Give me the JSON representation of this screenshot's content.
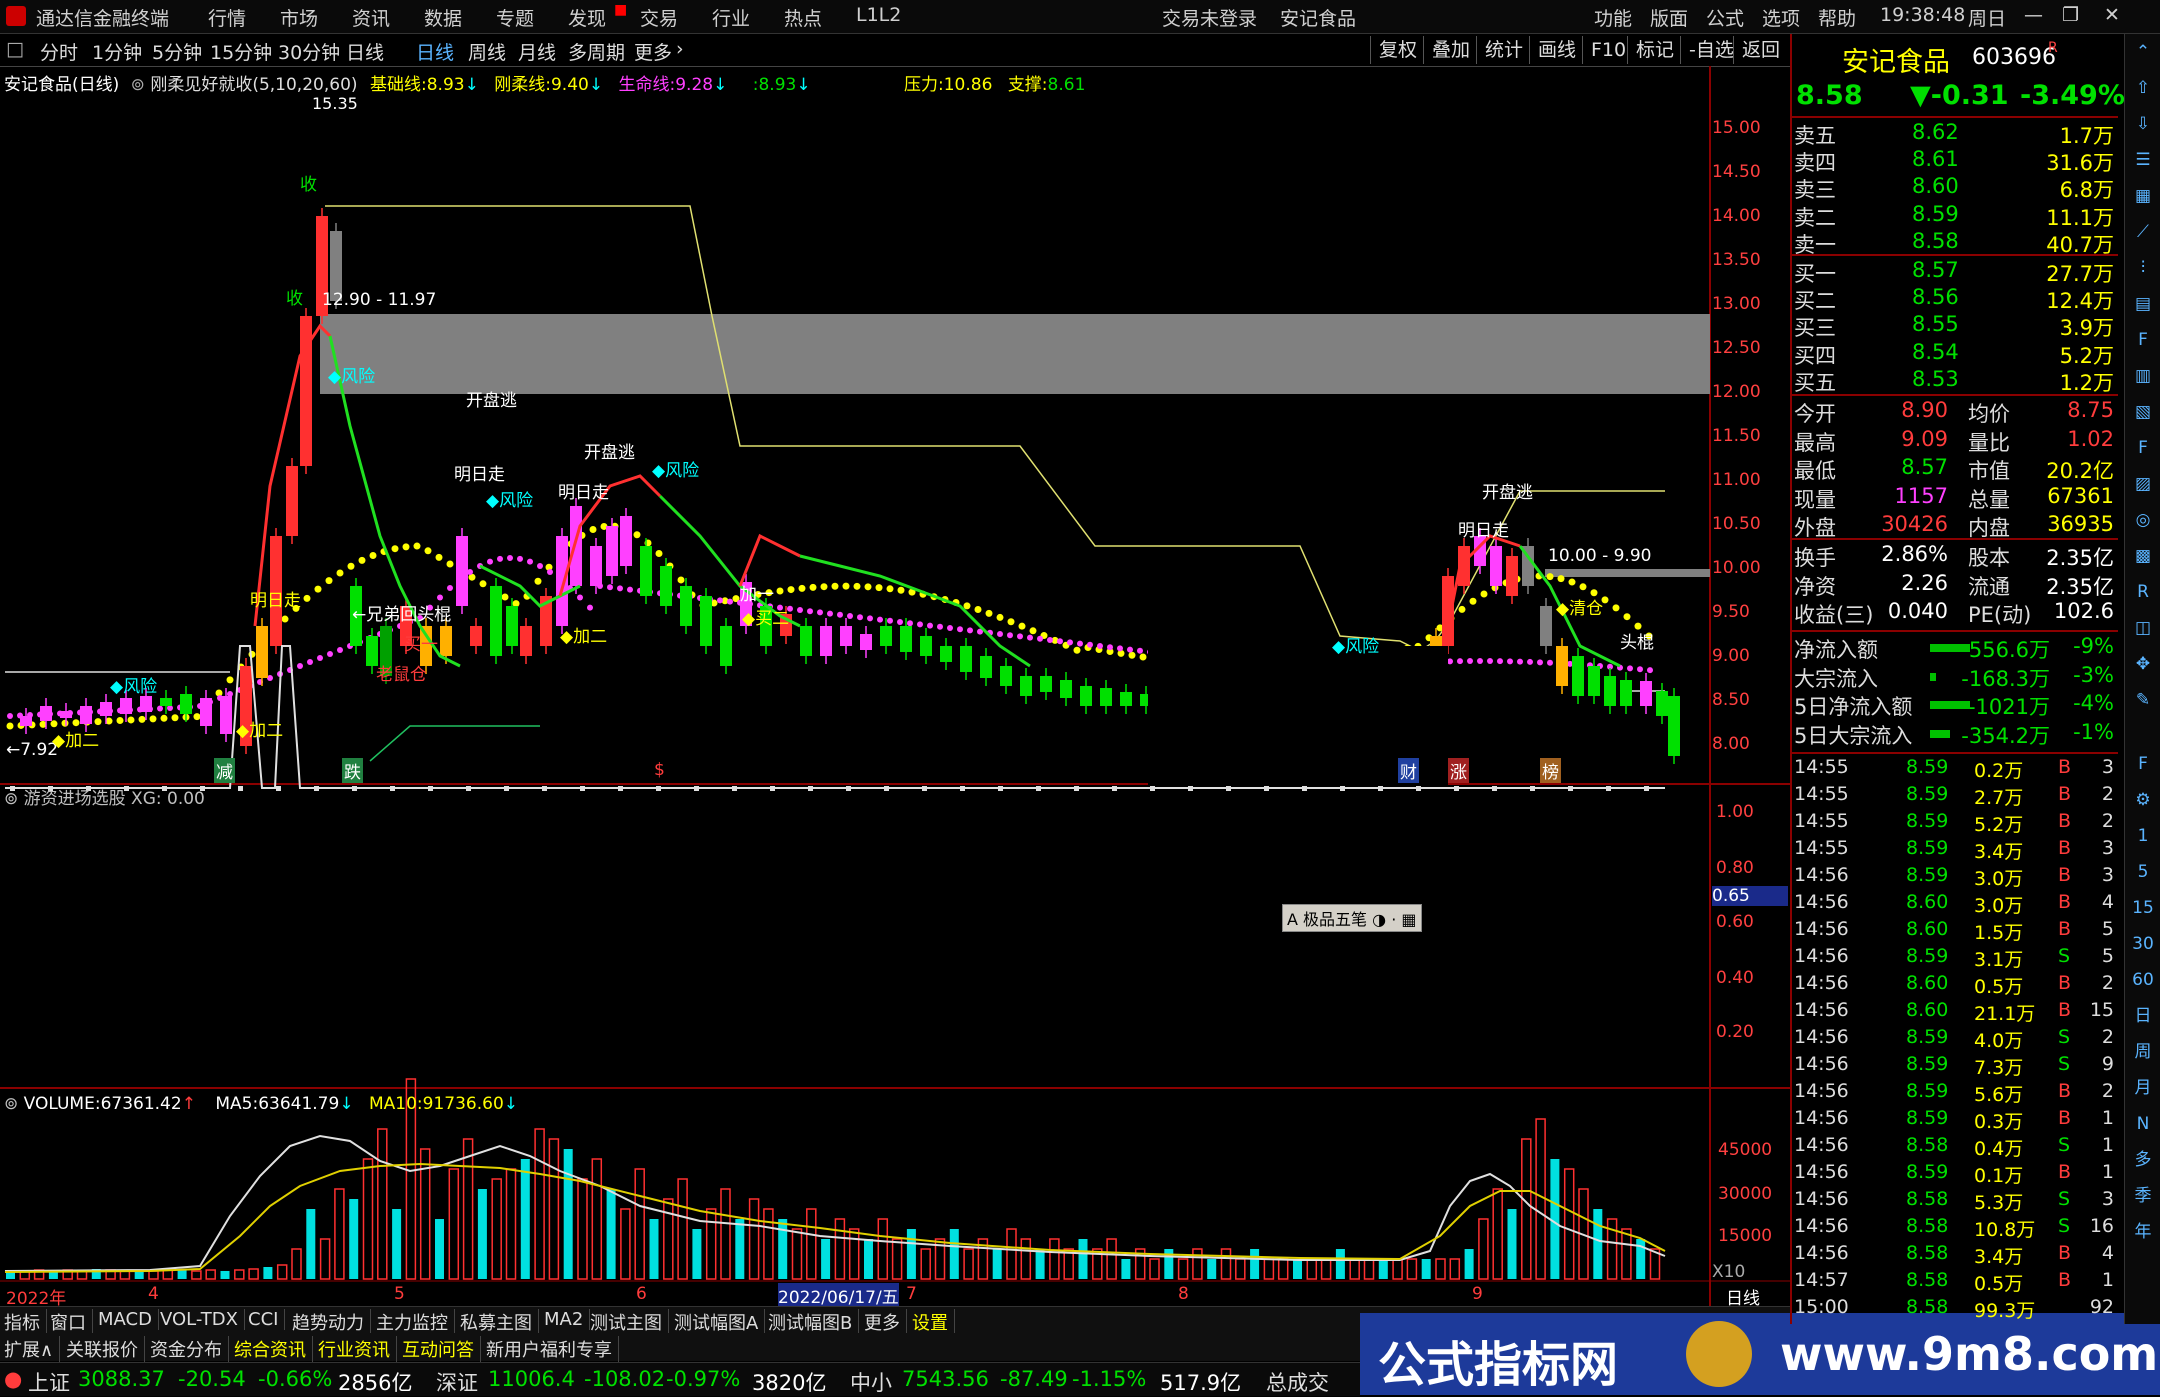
{
  "titlebar": {
    "app_title": "通达信金融终端",
    "menu": [
      "行情",
      "市场",
      "资讯",
      "数据",
      "专题",
      "发现",
      "交易",
      "行业",
      "热点",
      "L1L2"
    ],
    "trade_status": "交易未登录",
    "stock_name": "安记食品",
    "right_menu": [
      "功能",
      "版面",
      "公式",
      "选项",
      "帮助"
    ],
    "clock": "19:38:48",
    "weekday": "周日"
  },
  "periodbar": {
    "items": [
      "分时",
      "1分钟",
      "5分钟",
      "15分钟",
      "30分钟",
      "日线",
      "周线",
      "月线",
      "多周期",
      "更多"
    ],
    "active": "日线",
    "tools": [
      "复权",
      "叠加",
      "统计",
      "画线",
      "F10",
      "标记",
      "-自选",
      "返回"
    ]
  },
  "chart_header": {
    "name": "安记食品(日线)",
    "formula": "刚柔见好就收(5,10,20,60)",
    "base_label": "基础线:",
    "base_val": "8.93",
    "gang_label": "刚柔线:",
    "gang_val": "9.40",
    "life_label": "生命线:",
    "life_val": "9.28",
    "extra_val": ":8.93",
    "pressure_label": "压力:",
    "pressure_val": "10.86",
    "support_label": "支撑:",
    "support_val": "8.61"
  },
  "price_axis": [
    "15.00",
    "14.50",
    "14.00",
    "13.50",
    "13.00",
    "12.50",
    "12.00",
    "11.50",
    "11.00",
    "10.50",
    "10.00",
    "9.50",
    "9.00",
    "8.50",
    "8.00"
  ],
  "annotations": {
    "high": "15.35",
    "box_range": "12.90 - 11.97",
    "box2": "10.00 - 9.90",
    "low": "←7.92",
    "fengxian": "◆风险",
    "kaipantao": "开盘逃",
    "mingrizou": "明日走",
    "jiaer": "◆加二",
    "maiyi": "买一",
    "maier": "◆买二",
    "laoshucang": "老鼠仓",
    "xiongdi": "←兄弟回头棍",
    "shou": "收",
    "qingcang": "◆清仓",
    "jiayi": "加一",
    "ltouchg": "头棍"
  },
  "bottom_tags": {
    "jian": "减",
    "die": "跌",
    "s": "$",
    "cai": "财",
    "zhang": "涨",
    "bang": "榜"
  },
  "panel2": {
    "title": "游资进场选股 XG: 0.00",
    "axis": [
      "1.00",
      "0.80",
      "0.60",
      "0.40",
      "0.20"
    ],
    "cursor_val": "0.65",
    "toolbox": "极品五笔"
  },
  "panel3": {
    "vol_label": "VOLUME:",
    "vol_val": "67361.42",
    "ma5_label": "MA5:",
    "ma5_val": "63641.79",
    "ma10_label": "MA10:",
    "ma10_val": "91736.60",
    "axis": [
      "45000",
      "30000",
      "15000"
    ],
    "unit": "X10"
  },
  "date_axis": {
    "labels": [
      "2022年",
      "4",
      "5",
      "6",
      "7",
      "8",
      "9"
    ],
    "cursor_date": "2022/06/17/五",
    "mode": "日线"
  },
  "quote": {
    "name": "安记食品",
    "code": "603696",
    "flag": "R",
    "price": "8.58",
    "change": "▼-0.31",
    "pct": "-3.49%",
    "sells": [
      {
        "label": "卖五",
        "price": "8.62",
        "vol": "1.7万"
      },
      {
        "label": "卖四",
        "price": "8.61",
        "vol": "31.6万"
      },
      {
        "label": "卖三",
        "price": "8.60",
        "vol": "6.8万"
      },
      {
        "label": "卖二",
        "price": "8.59",
        "vol": "11.1万"
      },
      {
        "label": "卖一",
        "price": "8.58",
        "vol": "40.7万"
      }
    ],
    "buys": [
      {
        "label": "买一",
        "price": "8.57",
        "vol": "27.7万"
      },
      {
        "label": "买二",
        "price": "8.56",
        "vol": "12.4万"
      },
      {
        "label": "买三",
        "price": "8.55",
        "vol": "3.9万"
      },
      {
        "label": "买四",
        "price": "8.54",
        "vol": "5.2万"
      },
      {
        "label": "买五",
        "price": "8.53",
        "vol": "1.2万"
      }
    ],
    "stats1": [
      {
        "l": "今开",
        "v": "8.90",
        "l2": "均价",
        "v2": "8.75"
      },
      {
        "l": "最高",
        "v": "9.09",
        "l2": "量比",
        "v2": "1.02"
      },
      {
        "l": "最低",
        "v": "8.57",
        "l2": "市值",
        "v2": "20.2亿"
      },
      {
        "l": "现量",
        "v": "1157",
        "l2": "总量",
        "v2": "67361"
      },
      {
        "l": "外盘",
        "v": "30426",
        "l2": "内盘",
        "v2": "36935"
      }
    ],
    "stats2": [
      {
        "l": "换手",
        "v": "2.86%",
        "l2": "股本",
        "v2": "2.35亿"
      },
      {
        "l": "净资",
        "v": "2.26",
        "l2": "流通",
        "v2": "2.35亿"
      },
      {
        "l": "收益(三)",
        "v": "0.040",
        "l2": "PE(动)",
        "v2": "102.6"
      }
    ],
    "flows": [
      {
        "l": "净流入额",
        "v": "-556.6万",
        "p": "-9%"
      },
      {
        "l": "大宗流入",
        "v": "-168.3万",
        "p": "-3%"
      },
      {
        "l": "5日净流入额",
        "v": "-1021万",
        "p": "-4%"
      },
      {
        "l": "5日大宗流入",
        "v": "-354.2万",
        "p": "-1%"
      }
    ],
    "ticks": [
      [
        "14:55",
        "8.59",
        "0.2万",
        "B",
        "3"
      ],
      [
        "14:55",
        "8.59",
        "2.7万",
        "B",
        "2"
      ],
      [
        "14:55",
        "8.59",
        "5.2万",
        "B",
        "2"
      ],
      [
        "14:55",
        "8.59",
        "3.4万",
        "B",
        "3"
      ],
      [
        "14:56",
        "8.59",
        "3.0万",
        "B",
        "3"
      ],
      [
        "14:56",
        "8.60",
        "3.0万",
        "B",
        "4"
      ],
      [
        "14:56",
        "8.60",
        "1.5万",
        "B",
        "5"
      ],
      [
        "14:56",
        "8.59",
        "3.1万",
        "S",
        "5"
      ],
      [
        "14:56",
        "8.60",
        "0.5万",
        "B",
        "2"
      ],
      [
        "14:56",
        "8.60",
        "21.1万",
        "B",
        "15"
      ],
      [
        "14:56",
        "8.59",
        "4.0万",
        "S",
        "2"
      ],
      [
        "14:56",
        "8.59",
        "7.3万",
        "S",
        "9"
      ],
      [
        "14:56",
        "8.59",
        "5.6万",
        "B",
        "2"
      ],
      [
        "14:56",
        "8.59",
        "0.3万",
        "B",
        "1"
      ],
      [
        "14:56",
        "8.58",
        "0.4万",
        "S",
        "1"
      ],
      [
        "14:56",
        "8.59",
        "0.1万",
        "B",
        "1"
      ],
      [
        "14:56",
        "8.58",
        "5.3万",
        "S",
        "3"
      ],
      [
        "14:56",
        "8.58",
        "10.8万",
        "S",
        "16"
      ],
      [
        "14:56",
        "8.58",
        "3.4万",
        "B",
        "4"
      ],
      [
        "14:57",
        "8.58",
        "0.5万",
        "B",
        "1"
      ],
      [
        "15:00",
        "8.58",
        "99.3万",
        "",
        "92"
      ]
    ]
  },
  "tabs": [
    "指标",
    "窗口",
    "MACD",
    "VOL-TDX",
    "CCI",
    "趋势动力",
    "主力监控",
    "私募主图",
    "MA2",
    "测试主图",
    "测试幅图A",
    "测试幅图B",
    "更多",
    "设置"
  ],
  "tabs2": [
    "扩展∧",
    "关联报价",
    "资金分布",
    "综合资讯",
    "行业资讯",
    "互动问答",
    "新用户福利专享"
  ],
  "status": {
    "sh_label": "上证",
    "sh_val": "3088.37",
    "sh_chg": "-20.54",
    "sh_pct": "-0.66%",
    "sh_amt": "2856亿",
    "sz_label": "深证",
    "sz_val": "11006.4",
    "sz_chg": "-108.02",
    "sz_pct": "-0.97%",
    "sz_amt": "3820亿",
    "zx_label": "中小",
    "zx_val": "7543.56",
    "zx_chg": "-87.49",
    "zx_pct": "-1.15%",
    "zx_amt": "517.9亿",
    "total_label": "总成交"
  },
  "banner": {
    "text": "公式指标网",
    "url": "www.9m8.com"
  },
  "sidebar_labels": [
    "日",
    "周",
    "月",
    "N",
    "多",
    "季",
    "年"
  ]
}
